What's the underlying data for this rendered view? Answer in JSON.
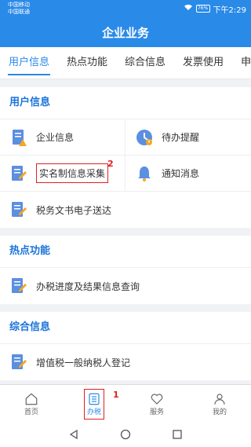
{
  "status_bar": {
    "carrier1": "中国移动",
    "carrier2": "中国联通",
    "battery": "76%",
    "time": "下午2:29"
  },
  "title": "企业业务",
  "tabs": [
    "用户信息",
    "热点功能",
    "综合信息",
    "发票使用",
    "申报"
  ],
  "sections": {
    "user_info": {
      "title": "用户信息",
      "items": [
        "企业信息",
        "待办提醒",
        "实名制信息采集",
        "通知消息",
        "税务文书电子送达"
      ]
    },
    "hot": {
      "title": "热点功能",
      "items": [
        "办税进度及结果信息查询"
      ]
    },
    "general": {
      "title": "综合信息",
      "items": [
        "增值税一般纳税人登记"
      ]
    }
  },
  "annotations": {
    "mark1": "1",
    "mark2": "2"
  },
  "bottom_nav": [
    "首页",
    "办税",
    "服务",
    "我的"
  ],
  "colors": {
    "primary": "#2a8ae8",
    "accent_red": "#e02020",
    "doc_icon": "#5b8fe0",
    "warn": "#f5a623"
  }
}
